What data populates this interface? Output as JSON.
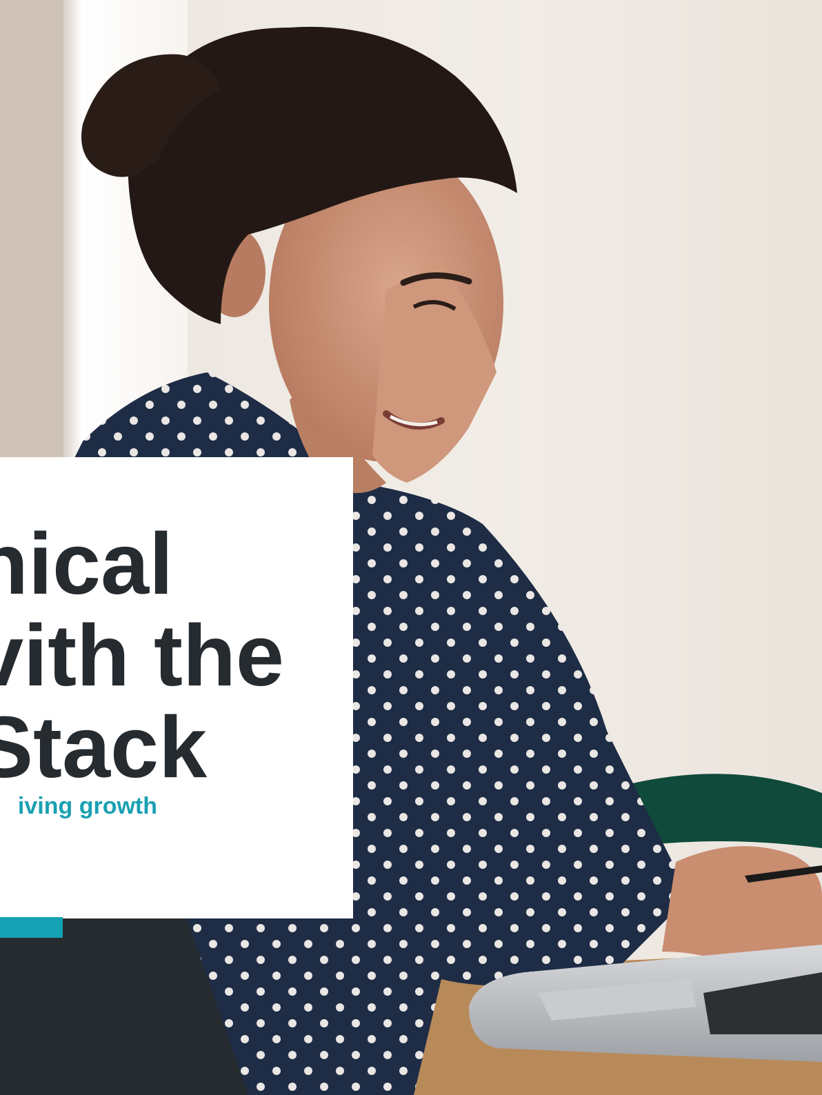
{
  "cover": {
    "title_lines": [
      "nical",
      "vith the",
      "Stack"
    ],
    "subtitle": "iving growth"
  },
  "colors": {
    "title": "#262b30",
    "accent": "#16a2b5",
    "subtitle": "#1aa0b2",
    "dark_panel": "#262b30",
    "card": "#ffffff"
  },
  "photo": {
    "description_icon": "woman-at-laptop-photo"
  }
}
